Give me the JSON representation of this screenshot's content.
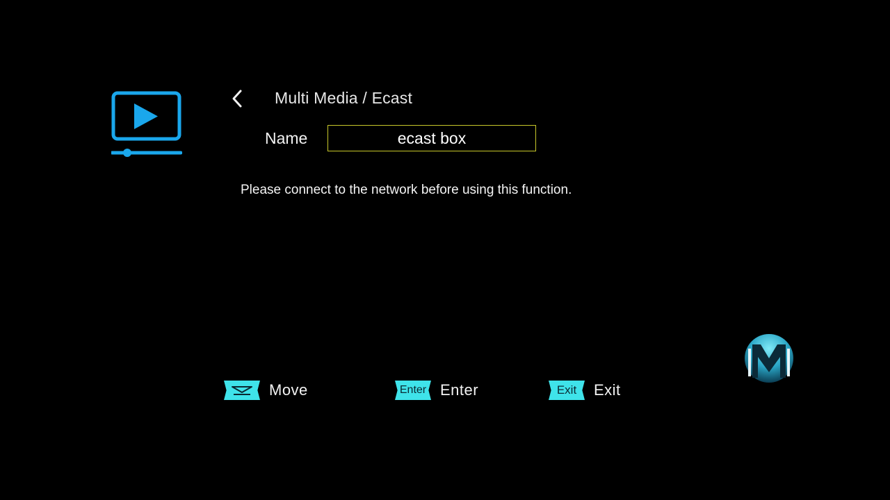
{
  "header": {
    "breadcrumb": "Multi Media / Ecast",
    "back_icon": "chevron-left-icon",
    "app_icon": "play-monitor-icon"
  },
  "form": {
    "name_label": "Name",
    "name_value": "ecast box"
  },
  "message": "Please connect to the network before using this function.",
  "hints": {
    "move": {
      "key": "",
      "label": "Move",
      "icon": "up-down-arrows-icon"
    },
    "enter": {
      "key": "Enter",
      "label": "Enter"
    },
    "exit": {
      "key": "Exit",
      "label": "Exit"
    }
  },
  "brand": {
    "logo": "m-logo-icon"
  },
  "colors": {
    "accent": "#1aa7ec",
    "key_badge": "#3fe3ea",
    "focus_border": "#c9c92a",
    "background": "#000000"
  }
}
